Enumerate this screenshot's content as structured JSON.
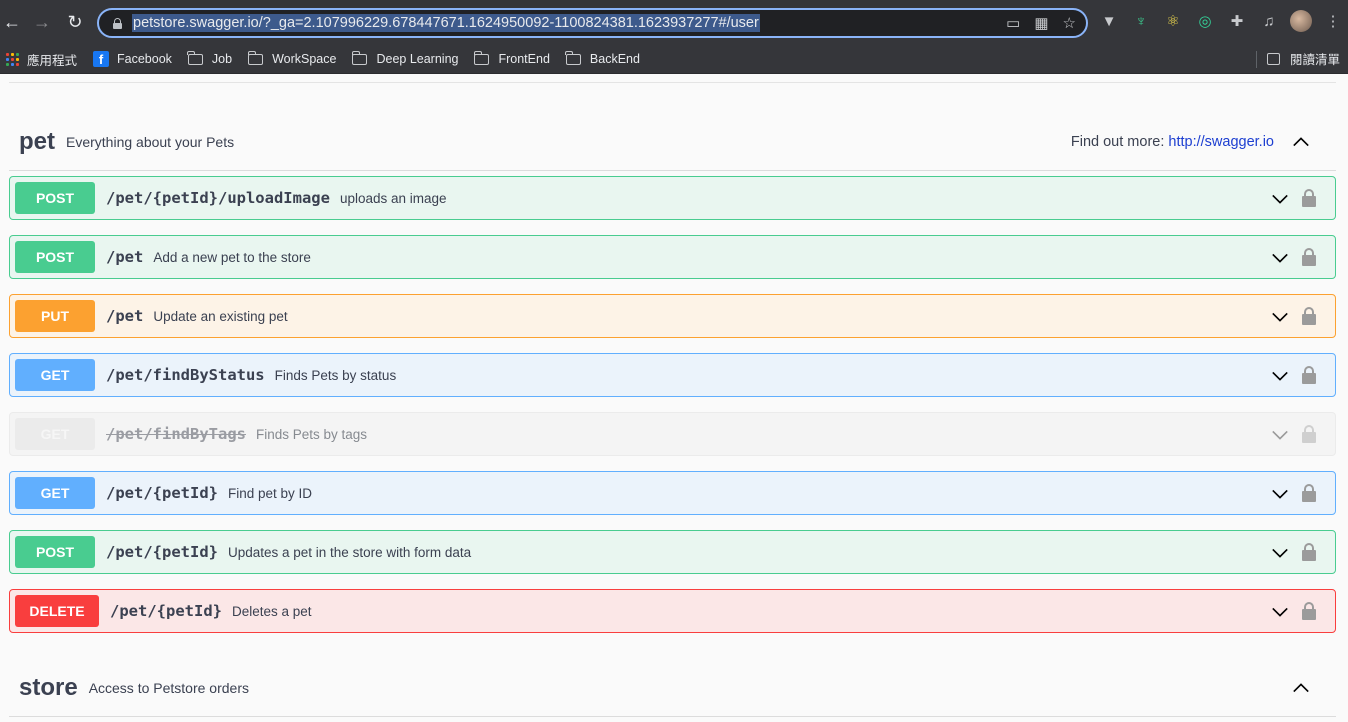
{
  "browser": {
    "url": "petstore.swagger.io/?_ga=2.107996229.678447671.1624950092-1100824381.1623937277#/user",
    "bookmarks": [
      {
        "label": "應用程式",
        "icon": "apps-grid-icon"
      },
      {
        "label": "Facebook",
        "icon": "facebook-icon"
      },
      {
        "label": "Job",
        "icon": "folder-icon"
      },
      {
        "label": "WorkSpace",
        "icon": "folder-icon"
      },
      {
        "label": "Deep Learning",
        "icon": "folder-icon"
      },
      {
        "label": "FrontEnd",
        "icon": "folder-icon"
      },
      {
        "label": "BackEnd",
        "icon": "folder-icon"
      }
    ],
    "reading_list_label": "閱讀清單"
  },
  "pet_tag": {
    "name": "pet",
    "description": "Everything about your Pets",
    "find_more_label": "Find out more:",
    "find_more_link": "http://swagger.io"
  },
  "operations": [
    {
      "method": "POST",
      "path": "/pet/{petId}/uploadImage",
      "summary": "uploads an image"
    },
    {
      "method": "POST",
      "path": "/pet",
      "summary": "Add a new pet to the store"
    },
    {
      "method": "PUT",
      "path": "/pet",
      "summary": "Update an existing pet"
    },
    {
      "method": "GET",
      "path": "/pet/findByStatus",
      "summary": "Finds Pets by status"
    },
    {
      "method": "GET",
      "path": "/pet/findByTags",
      "summary": "Finds Pets by tags",
      "deprecated": true
    },
    {
      "method": "GET",
      "path": "/pet/{petId}",
      "summary": "Find pet by ID"
    },
    {
      "method": "POST",
      "path": "/pet/{petId}",
      "summary": "Updates a pet in the store with form data"
    },
    {
      "method": "DELETE",
      "path": "/pet/{petId}",
      "summary": "Deletes a pet"
    }
  ],
  "store_tag": {
    "name": "store",
    "description": "Access to Petstore orders"
  },
  "colors": {
    "post": "#49cc90",
    "put": "#fca130",
    "get": "#61affe",
    "delete": "#f93e3e",
    "text": "#3b4151"
  }
}
